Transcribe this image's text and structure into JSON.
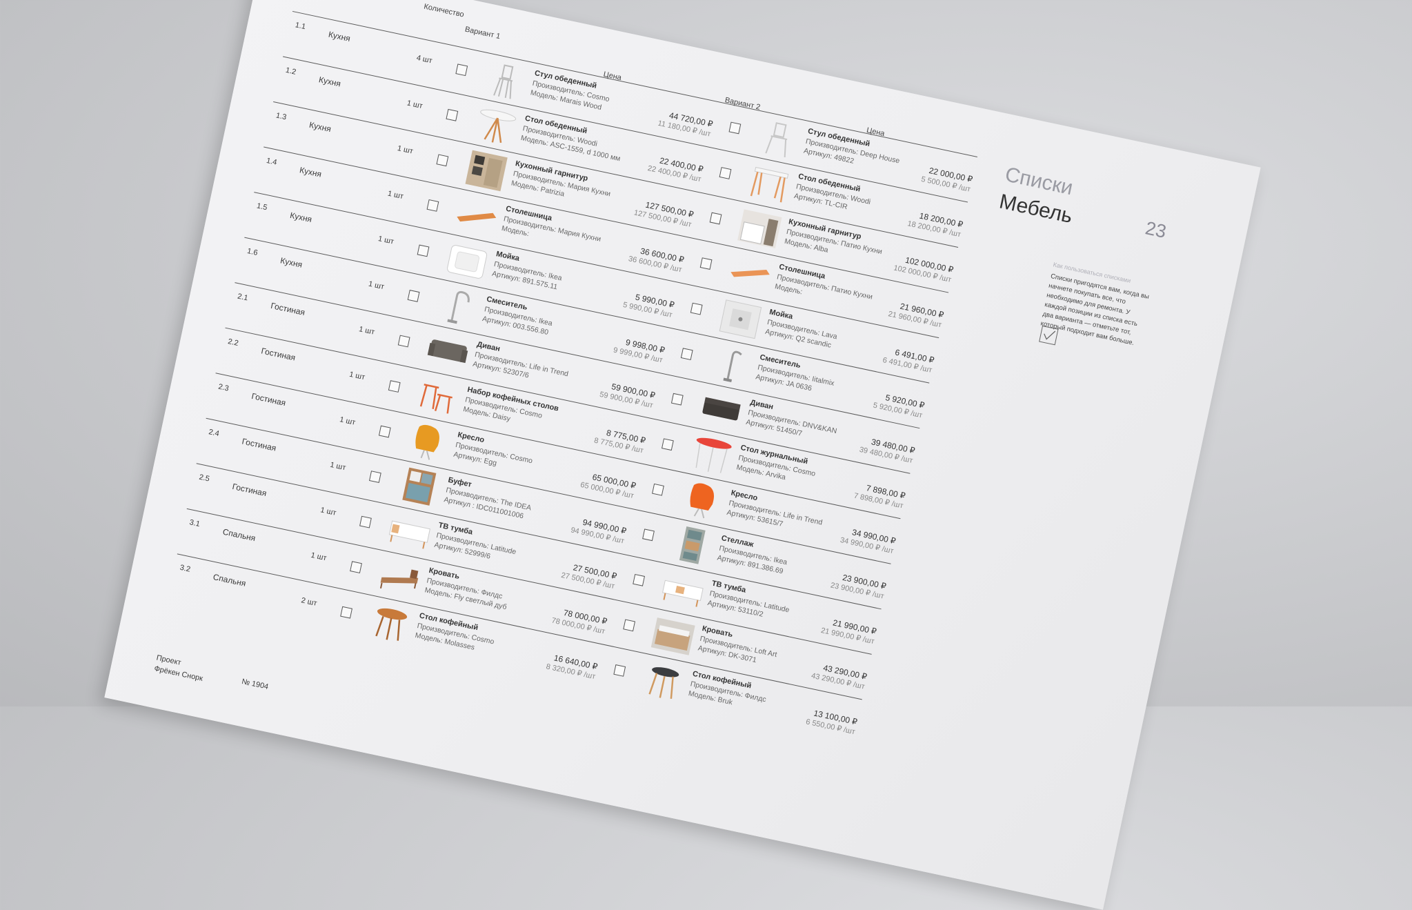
{
  "header": {
    "qty": "Количество",
    "variant1": "Вариант 1",
    "variant2": "Вариант 2",
    "price1": "Цена",
    "price2": "Цена"
  },
  "section": {
    "title_small": "Списки",
    "title_large": "Мебель",
    "page": "23"
  },
  "howto": {
    "label": "Как пользоваться списками",
    "text": "Списки пригодятся вам, когда вы начнете покупать все, что необходимо для ремонта. У каждой позиции из списка есть два варианта — отметьте тот, который подходит вам больше."
  },
  "footer": {
    "project_label": "Проект",
    "project_name": "Фрёкен Снорк",
    "number": "№ 1904"
  },
  "rows": [
    {
      "num": "1.1",
      "room": "Кухня",
      "qty": "4 шт",
      "v1": {
        "name": "Стул обеденный",
        "maker": "Производитель: Cosmo",
        "model": "Модель: Marais Wood",
        "price": "44 720,00 ₽",
        "unit": "11 180,00 ₽ /шт"
      },
      "v2": {
        "name": "Стул обеденный",
        "maker": "Производитель: Deep House",
        "model": "Артикул: 49822",
        "price": "22 000,00 ₽",
        "unit": "5 500,00 ₽ /шт"
      }
    },
    {
      "num": "1.2",
      "room": "Кухня",
      "qty": "1 шт",
      "v1": {
        "name": "Стол обеденный",
        "maker": "Производитель: Woodi",
        "model": "Модель: ASC-1559, d 1000 мм",
        "price": "22 400,00 ₽",
        "unit": "22 400,00 ₽ /шт"
      },
      "v2": {
        "name": "Стол обеденный",
        "maker": "Производитель: Woodi",
        "model": "Артикул: TL-CIR",
        "price": "18 200,00 ₽",
        "unit": "18 200,00 ₽ /шт"
      }
    },
    {
      "num": "1.3",
      "room": "Кухня",
      "qty": "1 шт",
      "v1": {
        "name": "Кухонный гарнитур",
        "maker": "Производитель: Мария Кухни",
        "model": "Модель: Patrizia",
        "price": "127 500,00 ₽",
        "unit": "127 500,00 ₽ /шт"
      },
      "v2": {
        "name": "Кухонный гарнитур",
        "maker": "Производитель: Патио Кухни",
        "model": "Модель: Alba",
        "price": "102 000,00 ₽",
        "unit": "102 000,00 ₽ /шт"
      }
    },
    {
      "num": "1.4",
      "room": "Кухня",
      "qty": "1 шт",
      "v1": {
        "name": "Столешница",
        "maker": "Производитель: Мария Кухни",
        "model": "Модель:",
        "price": "36 600,00 ₽",
        "unit": "36 600,00 ₽ /шт"
      },
      "v2": {
        "name": "Столешница",
        "maker": "Производитель: Патио Кухни",
        "model": "Модель:",
        "price": "21 960,00 ₽",
        "unit": "21 960,00 ₽ /шт"
      }
    },
    {
      "num": "1.5",
      "room": "Кухня",
      "qty": "1 шт",
      "v1": {
        "name": "Мойка",
        "maker": "Производитель: Ikea",
        "model": "Артикул: 891.575.11",
        "price": "5 990,00 ₽",
        "unit": "5 990,00 ₽ /шт"
      },
      "v2": {
        "name": "Мойка",
        "maker": "Производитель: Lava",
        "model": "Артикул: Q2 scandic",
        "price": "6 491,00 ₽",
        "unit": "6 491,00 ₽ /шт"
      }
    },
    {
      "num": "1.6",
      "room": "Кухня",
      "qty": "1 шт",
      "v1": {
        "name": "Смеситель",
        "maker": "Производитель: Ikea",
        "model": "Артикул: 003.556.80",
        "price": "9 998,00 ₽",
        "unit": "9 999,00 ₽ /шт"
      },
      "v2": {
        "name": "Смеситель",
        "maker": "Производитель: Iitalmix",
        "model": "Артикул: JA 0636",
        "price": "5 920,00 ₽",
        "unit": "5 920,00 ₽ /шт"
      }
    },
    {
      "num": "2.1",
      "room": "Гостиная",
      "qty": "1 шт",
      "v1": {
        "name": "Диван",
        "maker": "Производитель: Life in Trend",
        "model": "Артикул: 52307/6",
        "price": "59 900,00 ₽",
        "unit": "59 900,00 ₽ /шт"
      },
      "v2": {
        "name": "Диван",
        "maker": "Производитель: DNV&KAN",
        "model": "Артикул: 51450/7",
        "price": "39 480,00 ₽",
        "unit": "39 480,00 ₽ /шт"
      }
    },
    {
      "num": "2.2",
      "room": "Гостиная",
      "qty": "1 шт",
      "v1": {
        "name": "Набор кофейных столов",
        "maker": "Производитель: Cosmo",
        "model": "Модель: Daisy",
        "price": "8 775,00 ₽",
        "unit": "8 775,00 ₽ /шт"
      },
      "v2": {
        "name": "Стол журнальный",
        "maker": "Производитель: Cosmo",
        "model": "Модель: Arvika",
        "price": "7 898,00 ₽",
        "unit": "7 898,00 ₽ /шт"
      }
    },
    {
      "num": "2.3",
      "room": "Гостиная",
      "qty": "1 шт",
      "v1": {
        "name": "Кресло",
        "maker": "Производитель: Cosmo",
        "model": "Артикул: Egg",
        "price": "65 000,00 ₽",
        "unit": "65 000,00 ₽ /шт"
      },
      "v2": {
        "name": "Кресло",
        "maker": "Производитель: Life in Trend",
        "model": "Артикул: 53615/7",
        "price": "34 990,00 ₽",
        "unit": "34 990,00 ₽ /шт"
      }
    },
    {
      "num": "2.4",
      "room": "Гостиная",
      "qty": "1 шт",
      "v1": {
        "name": "Буфет",
        "maker": "Производитель: The IDEA",
        "model": "Артикул : IDC011001006",
        "price": "94 990,00 ₽",
        "unit": "94 990,00 ₽ /шт"
      },
      "v2": {
        "name": "Стеллаж",
        "maker": "Производитель: Ikea",
        "model": "Артикул: 891.386.69",
        "price": "23 900,00 ₽",
        "unit": "23 900,00 ₽ /шт"
      }
    },
    {
      "num": "2.5",
      "room": "Гостиная",
      "qty": "1 шт",
      "v1": {
        "name": "ТВ тумба",
        "maker": "Производитель: Latitude",
        "model": "Артикул: 52999/6",
        "price": "27 500,00 ₽",
        "unit": "27 500,00 ₽ /шт"
      },
      "v2": {
        "name": "ТВ тумба",
        "maker": "Производитель: Latitude",
        "model": "Артикул: 53110/2",
        "price": "21 990,00 ₽",
        "unit": "21 990,00 ₽ /шт"
      }
    },
    {
      "num": "3.1",
      "room": "Спальня",
      "qty": "1 шт",
      "v1": {
        "name": "Кровать",
        "maker": "Производитель: Филдс",
        "model": "Модель: Fly светлый дуб",
        "price": "78 000,00 ₽",
        "unit": "78 000,00 ₽ /шт"
      },
      "v2": {
        "name": "Кровать",
        "maker": "Производитель: Loft Art",
        "model": "Артикул: DK-3071",
        "price": "43 290,00 ₽",
        "unit": "43 290,00 ₽ /шт"
      }
    },
    {
      "num": "3.2",
      "room": "Спальня",
      "qty": "2 шт",
      "v1": {
        "name": "Стол кофейный",
        "maker": "Производитель: Cosmo",
        "model": "Модель: Molasses",
        "price": "16 640,00 ₽",
        "unit": "8 320,00 ₽ /шт"
      },
      "v2": {
        "name": "Стол кофейный",
        "maker": "Производитель: Филдс",
        "model": "Модель: Bruk",
        "price": "13 100,00 ₽",
        "unit": "6 550,00 ₽ /шт"
      }
    }
  ]
}
